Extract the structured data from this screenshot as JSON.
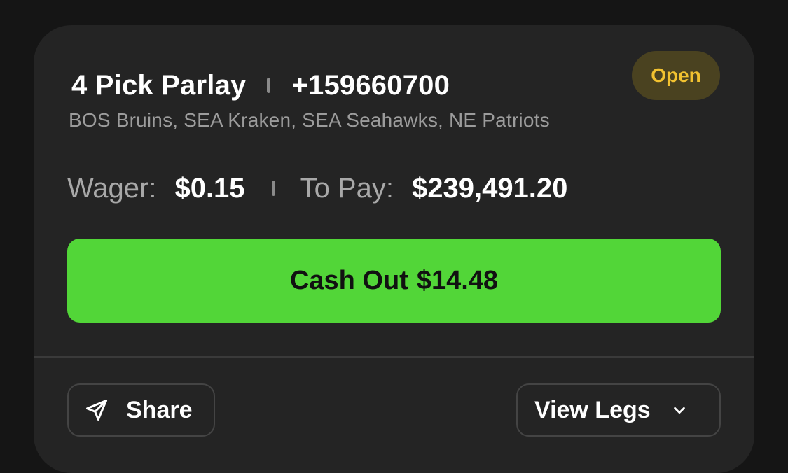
{
  "bet": {
    "title": "4 Pick Parlay",
    "odds": "+159660700",
    "status": "Open",
    "teams": "BOS Bruins, SEA Kraken, SEA Seahawks, NE Patriots",
    "wager_label": "Wager:",
    "wager_value": "$0.15",
    "to_pay_label": "To Pay:",
    "to_pay_value": "$239,491.20"
  },
  "actions": {
    "cashout_label": "Cash Out",
    "cashout_value": "$14.48",
    "share_label": "Share",
    "view_legs_label": "View Legs"
  },
  "icons": {
    "share": "send-icon",
    "view_legs": "chevron-down-icon"
  },
  "colors": {
    "background": "#151515",
    "card": "#242424",
    "cashout_green": "#52d638",
    "badge_bg": "#4a4220",
    "badge_text": "#f2c230"
  }
}
